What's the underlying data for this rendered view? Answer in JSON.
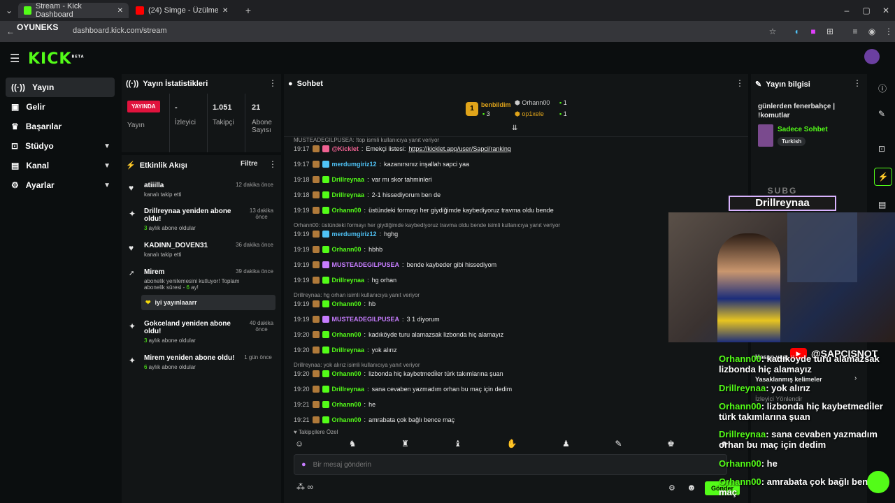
{
  "browser": {
    "tabs": [
      {
        "label": "Stream - Kick Dashboard"
      },
      {
        "label": "(24) Simge - Üzülmedin mi..."
      }
    ],
    "new_tab": "+",
    "url": "dashboard.kick.com/stream",
    "watermark": "OYUNEKS"
  },
  "header": {
    "logo": "KICK",
    "logo_sup": "BETA"
  },
  "sidebar": {
    "items": [
      {
        "label": "Yayın"
      },
      {
        "label": "Gelir"
      },
      {
        "label": "Başarılar"
      },
      {
        "label": "Stüdyo"
      },
      {
        "label": "Kanal"
      },
      {
        "label": "Ayarlar"
      }
    ]
  },
  "stats": {
    "title": "Yayın İstatistikleri",
    "live_badge": "YAYINDA",
    "live_label": "Yayın",
    "viewers_value": "-",
    "viewers_label": "İzleyici",
    "followers_value": "1.051",
    "followers_label": "Takipçi",
    "subs_value": "21",
    "subs_label": "Abone Sayısı"
  },
  "activity": {
    "title": "Etkinlik Akışı",
    "filter": "Filtre",
    "items": [
      {
        "title": "atiiilla",
        "sub": "kanalı takip etti",
        "time": "12 dakika önce"
      },
      {
        "title": "Drillreynaa yeniden abone oldu!",
        "sub_count": "3",
        "sub": " aylık abone oldular",
        "time": "13 dakika önce"
      },
      {
        "title": "KADINN_DOVEN31",
        "sub": "kanalı takip etti",
        "time": "36 dakika önce"
      },
      {
        "title": "Mirem",
        "sub": "abonelik yenilemesini kutluyor! Toplam abonelik süresi - ",
        "sub_count": "6",
        "sub_tail": " ay!",
        "time": "39 dakika önce",
        "message": "iyi yayınlaaarr"
      },
      {
        "title": "Gokceland yeniden abone oldu!",
        "sub_count": "3",
        "sub": " aylık abone oldular",
        "time": "40 dakika önce"
      },
      {
        "title": "Mirem yeniden abone oldu!",
        "sub_count": "6",
        "sub": " aylık abone oldular",
        "time": "1 gün önce"
      }
    ]
  },
  "chat": {
    "title": "Sohbet",
    "leaderboard": [
      {
        "rank": "1",
        "name": "benbildim",
        "count": "3"
      },
      {
        "name": "Orhann00",
        "count": "1"
      },
      {
        "name": "op1xele",
        "count": "1"
      }
    ],
    "messages": [
      {
        "reply": "MUSTEADEGILPUSEA: !top ismili kullanıcıya yanıt veriyor",
        "time": "19:17",
        "user": "@Kicklet",
        "color": "#f06292",
        "text": "Emekçi listesi: ",
        "link": "https://kicklet.app/user/Sapci/ranking"
      },
      {
        "time": "19:17",
        "user": "merdumgiriz12",
        "color": "#4fc3f7",
        "text": "kazanırsınız inşallah sapci yaa"
      },
      {
        "time": "19:18",
        "user": "Drillreynaa",
        "color": "#53fc18",
        "text": "var mı skor tahminleri"
      },
      {
        "time": "19:18",
        "user": "Drillreynaa",
        "color": "#53fc18",
        "text": "2-1 hissediyorum ben de"
      },
      {
        "time": "19:19",
        "user": "Orhann00",
        "color": "#53fc18",
        "text": "üstündeki formayı her giydiğimde kaybediyoruz travma oldu bende"
      },
      {
        "reply": "Orhann00: üstündeki formayı her giydiğimde kaybediyoruz travma oldu bende isimli kullanıcıya yanıt veriyor",
        "time": "19:19",
        "user": "merdumgiriz12",
        "color": "#4fc3f7",
        "text": "hghg"
      },
      {
        "time": "19:19",
        "user": "Orhann00",
        "color": "#53fc18",
        "text": "hbhb"
      },
      {
        "time": "19:19",
        "user": "MUSTEADEGILPUSEA",
        "color": "#c77dff",
        "text": "bende kaybeder gibi hissediyom"
      },
      {
        "time": "19:19",
        "user": "Drillreynaa",
        "color": "#53fc18",
        "text": "hg orhan"
      },
      {
        "reply": "Drillreynaa: hg orhan isimli kullanıcıya yanıt veriyor",
        "time": "19:19",
        "user": "Orhann00",
        "color": "#53fc18",
        "text": "hb"
      },
      {
        "time": "19:19",
        "user": "MUSTEADEGILPUSEA",
        "color": "#c77dff",
        "text": "3 1 diyorum"
      },
      {
        "time": "19:20",
        "user": "Orhann00",
        "color": "#53fc18",
        "text": "kadıköyde turu alamazsak lizbonda hiç alamayız"
      },
      {
        "time": "19:20",
        "user": "Drillreynaa",
        "color": "#53fc18",
        "text": "yok alırız"
      },
      {
        "reply": "Drillreynaa: yok alırız isimli kullanıcıya yanıt veriyor",
        "time": "19:20",
        "user": "Orhann00",
        "color": "#53fc18",
        "text": "lizbonda hiç kaybetmedi̇ler türk takımlarına şuan"
      },
      {
        "time": "19:20",
        "user": "Drillreynaa",
        "color": "#53fc18",
        "text": "sana cevaben yazmadım orhan bu maç için dedim"
      },
      {
        "time": "19:21",
        "user": "Orhann00",
        "color": "#53fc18",
        "text": "he"
      },
      {
        "time": "19:21",
        "user": "Orhann00",
        "color": "#53fc18",
        "text": "amrabata çok bağlı bence maç"
      }
    ],
    "emote_section": "Takipçilere Özel",
    "input_placeholder": "Bir mesaj gönderin",
    "infinity": "∞",
    "send": "Gönder"
  },
  "stream_info": {
    "title": "Yayın bilgisi",
    "stream_title": "günlerden fenerbahçe | !komutlar",
    "chat_mode": "Sadece Sohbet",
    "language": "Turkish",
    "rows": [
      {
        "label": "Hesap yaşı"
      },
      {
        "label": "Yasaklanmış kelimeler"
      },
      {
        "label": "İzleyici Yönlendir"
      }
    ]
  },
  "overlay": {
    "sub_label": "SUBG",
    "sub_name": "Drillreynaa",
    "youtube_handle": "@SAPCISNOT",
    "lines": [
      {
        "user": "Orhann00",
        "text": "kadıköyde turu alamazsak lizbonda hiç alamayız"
      },
      {
        "user": "Drillreynaa",
        "text": "yok alırız"
      },
      {
        "user": "Orhann00",
        "text": "lizbonda hiç kaybetmedi̇ler türk takımlarına şuan"
      },
      {
        "user": "Drillreynaa",
        "text": "sana cevaben yazmadım orhan bu maç için dedim"
      },
      {
        "user": "Orhann00",
        "text": "he"
      },
      {
        "user": "Orhann00",
        "text": "amrabata çok bağlı bence maç"
      }
    ]
  },
  "colors": {
    "accent": "#53fc18",
    "live": "#e0133d",
    "panel": "#121516"
  }
}
